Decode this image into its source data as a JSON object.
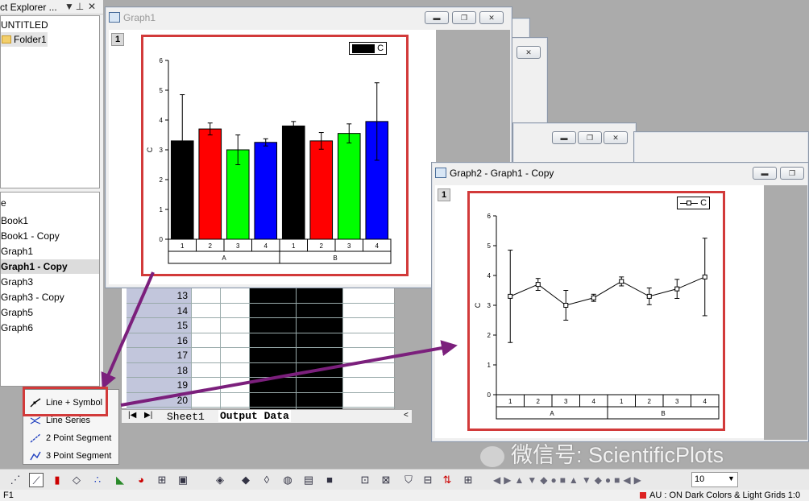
{
  "explorer": {
    "title": "ct Explorer ...",
    "tree": [
      "UNTITLED",
      "Folder1"
    ],
    "items": [
      "e",
      "Book1",
      "Book1 - Copy",
      "Graph1",
      "Graph1 - Copy",
      "Graph3",
      "Graph3 - Copy",
      "Graph5",
      "Graph6"
    ]
  },
  "graph1": {
    "title": "Graph1",
    "layer": "1"
  },
  "graph2": {
    "title": "Graph2 - Graph1 - Copy",
    "layer": "1"
  },
  "worksheet": {
    "rows": [
      "13",
      "14",
      "15",
      "16",
      "17",
      "18",
      "19",
      "20"
    ],
    "tabs": [
      "Sheet1",
      "Output Data"
    ]
  },
  "popup": {
    "items": [
      "Line + Symbol",
      "Line Series",
      "2 Point Segment",
      "3 Point Segment"
    ]
  },
  "toolbar": {
    "font_size": "10"
  },
  "status": {
    "left": "F1",
    "right": "AU : ON  Dark Colors & Light Grids  1:0"
  },
  "watermark": "微信号: ScientificPlots",
  "chart_data": [
    {
      "type": "bar",
      "categories": [
        "1",
        "2",
        "3",
        "4",
        "1",
        "2",
        "3",
        "4"
      ],
      "groups": [
        "A",
        "B"
      ],
      "values": [
        3.3,
        3.7,
        3.0,
        3.25,
        3.8,
        3.3,
        3.55,
        3.95
      ],
      "errors": [
        1.55,
        0.2,
        0.5,
        0.12,
        0.15,
        0.28,
        0.32,
        1.3
      ],
      "colors": [
        "#000000",
        "#ff0000",
        "#00ff00",
        "#0000ff",
        "#000000",
        "#ff0000",
        "#00ff00",
        "#0000ff"
      ],
      "series": [
        {
          "name": "C"
        }
      ],
      "ylabel": "C",
      "yticks": [
        "0",
        "1",
        "2",
        "3",
        "4",
        "5",
        "6"
      ],
      "ylim": [
        0,
        6
      ],
      "legend": "top-right"
    },
    {
      "type": "line",
      "categories": [
        "1",
        "2",
        "3",
        "4",
        "1",
        "2",
        "3",
        "4"
      ],
      "groups": [
        "A",
        "B"
      ],
      "values": [
        3.3,
        3.7,
        3.0,
        3.25,
        3.8,
        3.3,
        3.55,
        3.95
      ],
      "errors": [
        1.55,
        0.2,
        0.5,
        0.12,
        0.15,
        0.28,
        0.32,
        1.3
      ],
      "series": [
        {
          "name": "C"
        }
      ],
      "ylabel": "C",
      "yticks": [
        "0",
        "1",
        "2",
        "3",
        "4",
        "5",
        "6"
      ],
      "ylim": [
        0,
        6
      ],
      "legend": "top-right"
    }
  ]
}
